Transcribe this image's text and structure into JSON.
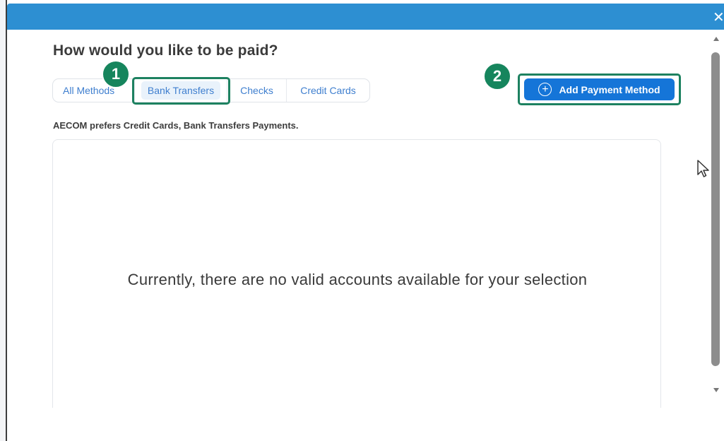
{
  "dialog": {
    "title": "How would you like to be paid?",
    "close_glyph": "✕",
    "preference_note": "AECOM prefers Credit Cards, Bank Transfers Payments.",
    "empty_message": "Currently, there are no valid accounts available for your selection"
  },
  "tabs": [
    {
      "label": "All Methods",
      "selected": false
    },
    {
      "label": "Bank Transfers",
      "selected": true
    },
    {
      "label": "Checks",
      "selected": false
    },
    {
      "label": "Credit Cards",
      "selected": false
    }
  ],
  "actions": {
    "add_payment_label": "Add Payment Method"
  },
  "annotations": {
    "step1": "1",
    "step2": "2"
  },
  "colors": {
    "titlebar": "#2d8fd2",
    "accent": "#1575d8",
    "highlight": "#1d8160",
    "tab_text": "#3f7fcf"
  },
  "icons": {
    "close": "close-icon",
    "add": "plus-circle-icon",
    "cursor": "mouse-pointer-icon"
  }
}
